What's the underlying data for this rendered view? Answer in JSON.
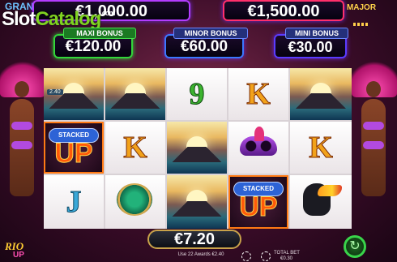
{
  "watermark": {
    "part1": "Slot",
    "part2": "Catalog",
    "suffix": ".com"
  },
  "jackpots": {
    "grand": {
      "word": "GRAND",
      "value": "€1,000.00",
      "color": "#b33cff"
    },
    "major": {
      "word": "MAJOR",
      "value": "€1,500.00",
      "color": "#ff2f6b"
    },
    "maxi": {
      "label": "MAXI BONUS",
      "value": "€120.00",
      "color": "#33d63a"
    },
    "minor": {
      "label": "MINOR BONUS",
      "value": "€60.00",
      "color": "#3b78ff"
    },
    "mini": {
      "label": "MINI BONUS",
      "value": "€30.00",
      "color": "#5a3cff"
    }
  },
  "reels": {
    "reel1": [
      "sunset",
      "stacked-up",
      "J"
    ],
    "reel2": [
      "sunset",
      "K",
      "peacock-fan"
    ],
    "reel3": [
      "9",
      "sunset",
      "sunset"
    ],
    "reel4": [
      "K",
      "carnival-mask",
      "stacked-up"
    ],
    "reel5": [
      "sunset",
      "K",
      "toucan"
    ]
  },
  "symbols": {
    "nine": "9",
    "king": "K",
    "jack": "J",
    "stacked_top": "STACKED",
    "stacked_bottom": "UP"
  },
  "win": {
    "amount": "€7.20"
  },
  "footer": {
    "lines_text": "Use 22 Awards €2.40",
    "total_bet_label": "TOTAL BET",
    "total_bet_value": "€0.30"
  },
  "small_badge": "2.40",
  "logo": {
    "text": "RIO",
    "sub": "UP"
  },
  "colors": {
    "accent_green": "#39d44a",
    "gold": "#c9a24a"
  }
}
